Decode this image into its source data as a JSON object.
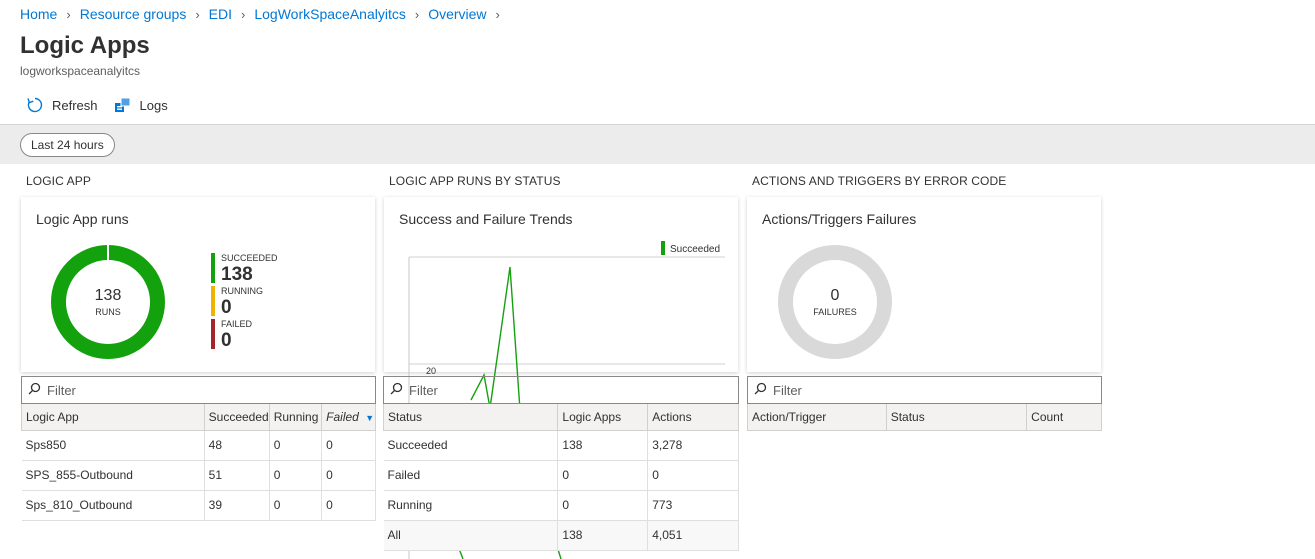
{
  "breadcrumb": [
    "Home",
    "Resource groups",
    "EDI",
    "LogWorkSpaceAnalyitcs",
    "Overview"
  ],
  "page": {
    "title": "Logic Apps",
    "subtitle": "logworkspaceanalyitcs"
  },
  "toolbar": {
    "refresh": "Refresh",
    "logs": "Logs"
  },
  "time_range": "Last 24 hours",
  "sections": {
    "logic_app": "LOGIC APP",
    "runs_by_status": "LOGIC APP RUNS BY STATUS",
    "actions_by_error": "ACTIONS AND TRIGGERS BY ERROR CODE"
  },
  "card1": {
    "title": "Logic App runs",
    "total": "138",
    "total_label": "RUNS",
    "legend": [
      {
        "label": "SUCCEEDED",
        "value": "138",
        "color": "#13a10e"
      },
      {
        "label": "RUNNING",
        "value": "0",
        "color": "#f2b200"
      },
      {
        "label": "FAILED",
        "value": "0",
        "color": "#a4262c"
      }
    ]
  },
  "card2": {
    "title": "Success and Failure Trends",
    "legend": "Succeeded",
    "tick": "20"
  },
  "card3": {
    "title": "Actions/Triggers Failures",
    "total": "0",
    "total_label": "FAILURES"
  },
  "filter_placeholder": "Filter",
  "table1": {
    "headers": [
      "Logic App",
      "Succeeded",
      "Running",
      "Failed"
    ],
    "rows": [
      [
        "Sps850",
        "48",
        "0",
        "0"
      ],
      [
        "SPS_855-Outbound",
        "51",
        "0",
        "0"
      ],
      [
        "Sps_810_Outbound",
        "39",
        "0",
        "0"
      ]
    ]
  },
  "table2": {
    "headers": [
      "Status",
      "Logic Apps",
      "Actions"
    ],
    "rows": [
      [
        "Succeeded",
        "138",
        "3,278"
      ],
      [
        "Failed",
        "0",
        "0"
      ],
      [
        "Running",
        "0",
        "773"
      ],
      [
        "All",
        "138",
        "4,051"
      ]
    ]
  },
  "table3": {
    "headers": [
      "Action/Trigger",
      "Status",
      "Count"
    ]
  },
  "colors": {
    "accent": "#0078d4",
    "success": "#13a10e",
    "neutral": "#d9d9d9"
  }
}
